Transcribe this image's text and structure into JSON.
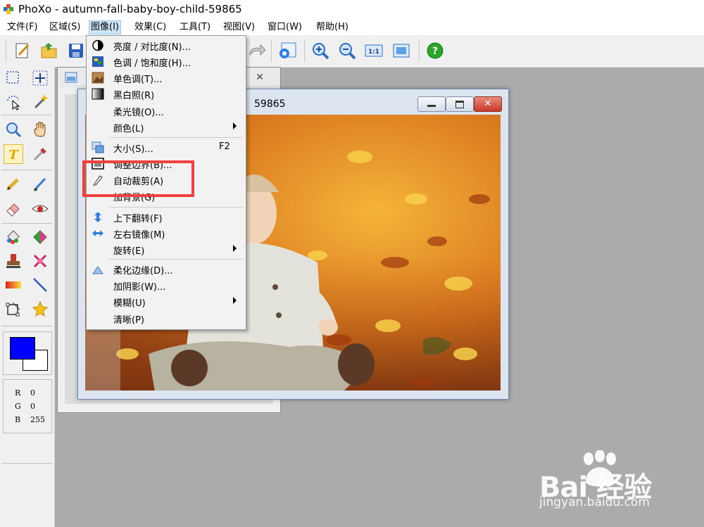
{
  "window": {
    "title": "PhoXo - autumn-fall-baby-boy-child-59865"
  },
  "menubar": {
    "items": [
      {
        "label": "文件(F)"
      },
      {
        "label": "区域(S)"
      },
      {
        "label": "图像(I)"
      },
      {
        "label": "效果(C)"
      },
      {
        "label": "工具(T)"
      },
      {
        "label": "视图(V)"
      },
      {
        "label": "窗口(W)"
      },
      {
        "label": "帮助(H)"
      }
    ],
    "active_index": 2
  },
  "toolbar": {
    "buttons": [
      "new-icon",
      "open-icon",
      "save-icon",
      "redo-icon",
      "settings-icon",
      "zoom-in-icon",
      "zoom-out-icon",
      "actual-size-icon",
      "fit-window-icon",
      "help-icon"
    ],
    "actual_size_label": "1:1"
  },
  "image_menu": {
    "items": [
      {
        "label": "亮度 / 对比度(N)...",
        "icon": "brightness-icon"
      },
      {
        "label": "色调 / 饱和度(H)...",
        "icon": "hue-icon"
      },
      {
        "label": "单色调(T)...",
        "icon": "monotone-icon"
      },
      {
        "label": "黑白照(R)",
        "icon": "grayscale-icon"
      },
      {
        "label": "柔光镜(O)...",
        "icon": ""
      },
      {
        "label": "颜色(L)",
        "icon": "",
        "submenu": true
      },
      {
        "label": "大小(S)...",
        "icon": "resize-icon",
        "shortcut": "F2"
      },
      {
        "label": "调整边界(B)...",
        "icon": "canvas-icon"
      },
      {
        "label": "自动裁剪(A)",
        "icon": "knife-icon"
      },
      {
        "label": "加背景(G)",
        "icon": ""
      },
      {
        "label": "上下翻转(F)",
        "icon": "flip-vertical-icon"
      },
      {
        "label": "左右镜像(M)",
        "icon": "flip-horizontal-icon"
      },
      {
        "label": "旋转(E)",
        "icon": "",
        "submenu": true
      },
      {
        "label": "柔化边缘(D)...",
        "icon": "feather-icon"
      },
      {
        "label": "加阴影(W)...",
        "icon": ""
      },
      {
        "label": "模糊(U)",
        "icon": "",
        "submenu": true
      },
      {
        "label": "清晰(P)",
        "icon": ""
      }
    ]
  },
  "document": {
    "title_fragment": "59865"
  },
  "colors": {
    "foreground": "#0000FF",
    "background": "#FFFFFF",
    "rgb": [
      {
        "k": "R",
        "v": "0"
      },
      {
        "k": "G",
        "v": "0"
      },
      {
        "k": "B",
        "v": "255"
      }
    ]
  },
  "watermark": {
    "brand": "Bai  经验",
    "url": "jingyan.baidu.com"
  }
}
